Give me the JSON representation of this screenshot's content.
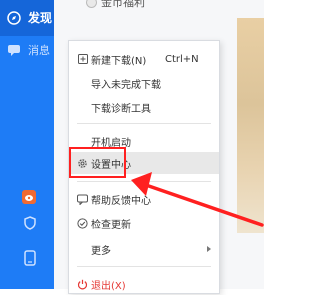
{
  "sidebar": {
    "items": [
      {
        "label": "发现",
        "icon": "discover-icon"
      },
      {
        "label": "消息",
        "icon": "message-icon"
      },
      {
        "label": "",
        "icon": "weibo-icon"
      },
      {
        "label": "",
        "icon": "shield-icon"
      },
      {
        "label": "",
        "icon": "phone-icon"
      }
    ]
  },
  "top_bar": {
    "coin_label": "金币福利"
  },
  "context_menu": {
    "items": [
      {
        "label": "新建下载(N)",
        "shortcut": "Ctrl+N",
        "icon": "new-download-icon"
      },
      {
        "label": "导入未完成下载"
      },
      {
        "label": "下载诊断工具"
      },
      {
        "label": "开机启动"
      },
      {
        "label": "设置中心",
        "icon": "gear-icon"
      },
      {
        "label": "帮助反馈中心",
        "icon": "help-icon"
      },
      {
        "label": "检查更新",
        "icon": "check-icon"
      },
      {
        "label": "更多"
      },
      {
        "label": "退出(X)",
        "icon": "power-icon"
      }
    ]
  },
  "colors": {
    "sidebar": "#1e7cf6",
    "highlight": "#ff2020",
    "danger": "#e53935"
  }
}
